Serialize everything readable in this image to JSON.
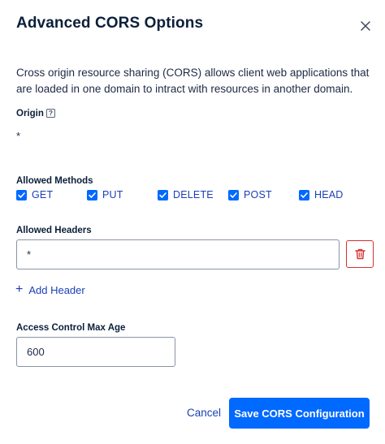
{
  "dialog": {
    "title": "Advanced CORS Options",
    "description": "Cross origin resource sharing (CORS) allows client web applications that are loaded in one domain to intract with resources in another domain."
  },
  "origin": {
    "label": "Origin",
    "help_glyph": "?",
    "value": "*"
  },
  "methods": {
    "label": "Allowed Methods",
    "items": [
      {
        "label": "GET",
        "checked": true
      },
      {
        "label": "PUT",
        "checked": true
      },
      {
        "label": "DELETE",
        "checked": true
      },
      {
        "label": "POST",
        "checked": true
      },
      {
        "label": "HEAD",
        "checked": true
      }
    ]
  },
  "headers": {
    "label": "Allowed Headers",
    "values": [
      "*"
    ],
    "add_label": "Add Header",
    "add_glyph": "+"
  },
  "max_age": {
    "label": "Access Control Max Age",
    "value": "600"
  },
  "footer": {
    "cancel_label": "Cancel",
    "save_label": "Save CORS Configuration"
  },
  "colors": {
    "accent": "#0069ff",
    "link": "#1a3fb8",
    "danger": "#d62f2f",
    "text": "#0b1f3a"
  },
  "icons": {
    "close": "close-icon",
    "help": "help-icon",
    "check": "check-icon",
    "delete": "trash-icon",
    "add": "plus-icon"
  }
}
